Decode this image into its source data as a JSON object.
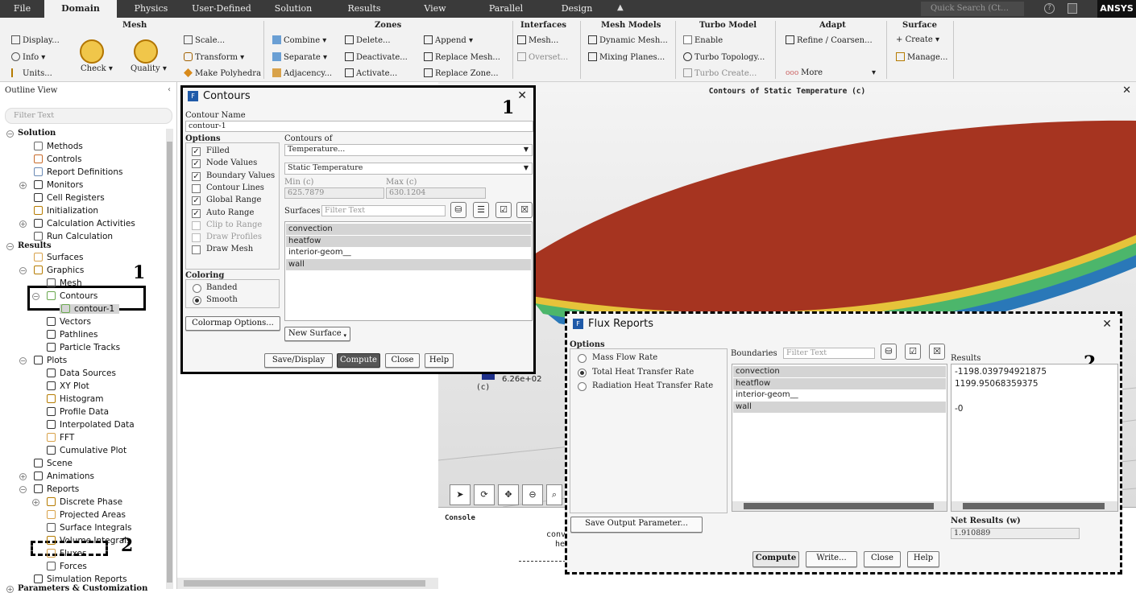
{
  "menubar": {
    "tabs": [
      "File",
      "Domain",
      "Physics",
      "User-Defined",
      "Solution",
      "Results",
      "View",
      "Parallel",
      "Design"
    ],
    "active": "Domain",
    "search_placeholder": "Quick Search (Ct…",
    "brand": "ANSYS"
  },
  "ribbon": {
    "mesh": {
      "title": "Mesh",
      "display": "Display...",
      "info": "Info",
      "units": "Units...",
      "check": "Check",
      "quality": "Quality",
      "scale": "Scale...",
      "transform": "Transform",
      "make_polyhedra": "Make Polyhedra"
    },
    "zones": {
      "title": "Zones",
      "combine": "Combine",
      "separate": "Separate",
      "adjacency": "Adjacency...",
      "delete": "Delete...",
      "deactivate": "Deactivate...",
      "activate": "Activate...",
      "append": "Append",
      "replace_mesh": "Replace Mesh...",
      "replace_zone": "Replace Zone..."
    },
    "interfaces": {
      "title": "Interfaces",
      "mesh": "Mesh...",
      "overset": "Overset..."
    },
    "mesh_models": {
      "title": "Mesh Models",
      "dynamic_mesh": "Dynamic Mesh...",
      "mixing_planes": "Mixing Planes..."
    },
    "turbo": {
      "title": "Turbo Model",
      "enable": "Enable",
      "topology": "Turbo Topology...",
      "create": "Turbo Create..."
    },
    "adapt": {
      "title": "Adapt",
      "refine": "Refine / Coarsen...",
      "more": "More"
    },
    "surface": {
      "title": "Surface",
      "create": "Create",
      "manage": "Manage..."
    }
  },
  "outline": {
    "title": "Outline View",
    "filter_placeholder": "Filter Text",
    "items": [
      "Solution",
      "Methods",
      "Controls",
      "Report Definitions",
      "Monitors",
      "Cell Registers",
      "Initialization",
      "Calculation Activities",
      "Run Calculation",
      "Results",
      "Surfaces",
      "Graphics",
      "Mesh",
      "Contours",
      "contour-1",
      "Vectors",
      "Pathlines",
      "Particle Tracks",
      "Plots",
      "Data Sources",
      "XY Plot",
      "Histogram",
      "Profile Data",
      "Interpolated Data",
      "FFT",
      "Cumulative Plot",
      "Scene",
      "Animations",
      "Reports",
      "Discrete Phase",
      "Projected Areas",
      "Surface Integrals",
      "Volume Integrals",
      "Fluxes",
      "Forces",
      "Simulation Reports",
      "Parameters & Customization"
    ]
  },
  "graphics": {
    "title": "Contours of Static Temperature (c)",
    "legend_value": "6.26e+02",
    "unit": "(c)",
    "console_label": "Console",
    "console_lines": [
      "conv",
      "he"
    ]
  },
  "contours": {
    "title": "Contours",
    "annotation": "1",
    "name_label": "Contour Name",
    "name_value": "contour-1",
    "options_label": "Options",
    "options": [
      {
        "label": "Filled",
        "checked": true
      },
      {
        "label": "Node Values",
        "checked": true
      },
      {
        "label": "Boundary Values",
        "checked": true
      },
      {
        "label": "Contour Lines",
        "checked": false
      },
      {
        "label": "Global Range",
        "checked": true
      },
      {
        "label": "Auto Range",
        "checked": true
      },
      {
        "label": "Clip to Range",
        "checked": false,
        "disabled": true
      },
      {
        "label": "Draw Profiles",
        "checked": false,
        "disabled": true
      },
      {
        "label": "Draw Mesh",
        "checked": false
      }
    ],
    "contours_of_label": "Contours of",
    "field": "Temperature...",
    "subfield": "Static Temperature",
    "min_label": "Min (c)",
    "min_value": "625.7879",
    "max_label": "Max (c)",
    "max_value": "630.1204",
    "surfaces_label": "Surfaces",
    "surfaces_filter": "Filter Text",
    "surfaces": [
      {
        "name": "convection",
        "selected": true
      },
      {
        "name": "heatfow",
        "selected": true
      },
      {
        "name": "interior-geom__",
        "selected": false
      },
      {
        "name": "wall",
        "selected": true
      }
    ],
    "coloring_label": "Coloring",
    "coloring": [
      {
        "label": "Banded",
        "selected": false
      },
      {
        "label": "Smooth",
        "selected": true
      }
    ],
    "colormap_button": "Colormap Options...",
    "new_surface": "New Surface",
    "buttons": [
      "Save/Display",
      "Compute",
      "Close",
      "Help"
    ]
  },
  "flux": {
    "title": "Flux Reports",
    "annotation": "2",
    "options_label": "Options",
    "options": [
      {
        "label": "Mass Flow Rate",
        "selected": false
      },
      {
        "label": "Total Heat Transfer Rate",
        "selected": true
      },
      {
        "label": "Radiation Heat Transfer Rate",
        "selected": false
      }
    ],
    "boundaries_label": "Boundaries",
    "boundaries_filter": "Filter Text",
    "boundaries": [
      {
        "name": "convection",
        "selected": true
      },
      {
        "name": "heatflow",
        "selected": true
      },
      {
        "name": "interior-geom__",
        "selected": false
      },
      {
        "name": "wall",
        "selected": true
      }
    ],
    "results_label": "Results",
    "results": [
      "-1198.039794921875",
      "1199.95068359375",
      "",
      "-0"
    ],
    "save_button": "Save Output Parameter...",
    "net_label": "Net Results (w)",
    "net_value": "1.910889",
    "buttons": [
      "Compute",
      "Write...",
      "Close",
      "Help"
    ]
  },
  "annotations": {
    "outline_box_1": "1",
    "outline_box_2": "2"
  },
  "colors": {
    "menubar": "#3a3a3a",
    "ribbon": "#f2f2f2",
    "surface": "#a63420",
    "selection": "#d4d4d4"
  }
}
